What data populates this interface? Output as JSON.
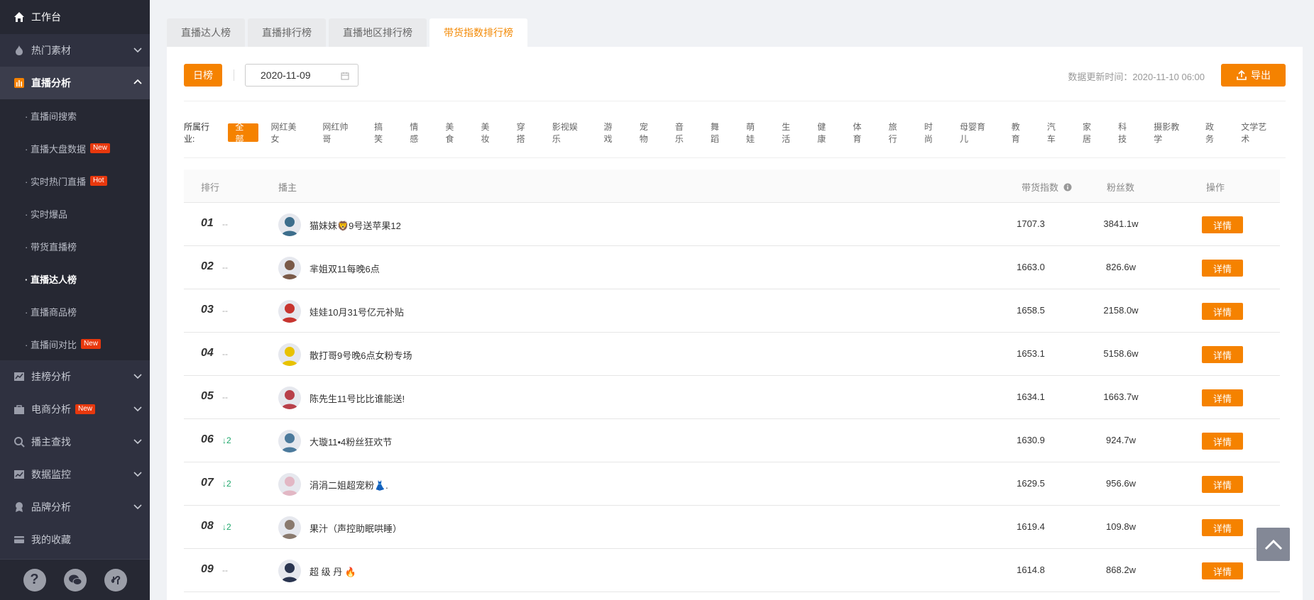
{
  "sidebar": {
    "top": {
      "label": "工作台",
      "icon": "home-icon"
    },
    "groups": [
      {
        "label": "热门素材",
        "icon": "fire-icon"
      },
      {
        "label": "直播分析",
        "icon": "bar-chart-icon"
      }
    ],
    "sub_items": [
      {
        "label": "· 直播间搜索",
        "badge": ""
      },
      {
        "label": "· 直播大盘数据",
        "badge": "New"
      },
      {
        "label": "· 实时热门直播",
        "badge": "Hot"
      },
      {
        "label": "· 实时爆品",
        "badge": ""
      },
      {
        "label": "· 带货直播榜",
        "badge": ""
      },
      {
        "label": "· 直播达人榜",
        "badge": ""
      },
      {
        "label": "· 直播商品榜",
        "badge": ""
      },
      {
        "label": "· 直播间对比",
        "badge": "New"
      }
    ],
    "more_groups": [
      {
        "label": "挂榜分析",
        "icon": "trend-icon",
        "badge": ""
      },
      {
        "label": "电商分析",
        "icon": "bag-icon",
        "badge": "New"
      },
      {
        "label": "播主查找",
        "icon": "search-icon",
        "badge": ""
      },
      {
        "label": "数据监控",
        "icon": "monitor-icon",
        "badge": ""
      },
      {
        "label": "品牌分析",
        "icon": "brand-icon",
        "badge": ""
      },
      {
        "label": "我的收藏",
        "icon": "card-icon",
        "badge": ""
      }
    ]
  },
  "tabs": [
    "直播达人榜",
    "直播排行榜",
    "直播地区排行榜",
    "带货指数排行榜"
  ],
  "toolbar": {
    "day_label": "日榜",
    "date_value": "2020-11-09",
    "update_time": "数据更新时间：2020-11-10 06:00",
    "export_label": "导出"
  },
  "industry": {
    "label": "所属行业:",
    "options": [
      "全部",
      "网红美女",
      "网红帅哥",
      "搞笑",
      "情感",
      "美食",
      "美妆",
      "穿搭",
      "影视娱乐",
      "游戏",
      "宠物",
      "音乐",
      "舞蹈",
      "萌娃",
      "生活",
      "健康",
      "体育",
      "旅行",
      "时尚",
      "母婴育儿",
      "教育",
      "汽车",
      "家居",
      "科技",
      "摄影教学",
      "政务",
      "文学艺术"
    ]
  },
  "table": {
    "headers": {
      "rank": "排行",
      "host": "播主",
      "score": "带货指数",
      "fans": "粉丝数",
      "action": "操作"
    },
    "detail_label": "详情",
    "rows": [
      {
        "rank": "01",
        "trend": "--",
        "name": "猫妹妹🦁9号送苹果12",
        "score": "1707.3",
        "fans": "3841.1w",
        "avatar_color": "#3d6e8c"
      },
      {
        "rank": "02",
        "trend": "--",
        "name": "芈姐双11每晚6点",
        "score": "1663.0",
        "fans": "826.6w",
        "avatar_color": "#7a5a48"
      },
      {
        "rank": "03",
        "trend": "--",
        "name": "娃娃10月31号亿元补贴",
        "score": "1658.5",
        "fans": "2158.0w",
        "avatar_color": "#c7352f"
      },
      {
        "rank": "04",
        "trend": "--",
        "name": "散打哥9号晚6点女粉专场",
        "score": "1653.1",
        "fans": "5158.6w",
        "avatar_color": "#e8c200"
      },
      {
        "rank": "05",
        "trend": "--",
        "name": "陈先生11号比比谁能送!",
        "score": "1634.1",
        "fans": "1663.7w",
        "avatar_color": "#b8404a"
      },
      {
        "rank": "06",
        "trend": "↓2",
        "name": "大璇11•4粉丝狂欢节",
        "score": "1630.9",
        "fans": "924.7w",
        "avatar_color": "#4c7a9c"
      },
      {
        "rank": "07",
        "trend": "↓2",
        "name": "涓涓二姐超宠粉👗.",
        "score": "1629.5",
        "fans": "956.6w",
        "avatar_color": "#e2b7c4"
      },
      {
        "rank": "08",
        "trend": "↓2",
        "name": "果汁（声控助眠哄睡）",
        "score": "1619.4",
        "fans": "109.8w",
        "avatar_color": "#8a7a6e"
      },
      {
        "rank": "09",
        "trend": "--",
        "name": "超 级 丹 🔥",
        "score": "1614.8",
        "fans": "868.2w",
        "avatar_color": "#2a3550"
      }
    ]
  },
  "colors": {
    "accent": "#f58200",
    "sidebar_bg": "#2f3140",
    "trend_down": "#1ea86b"
  }
}
